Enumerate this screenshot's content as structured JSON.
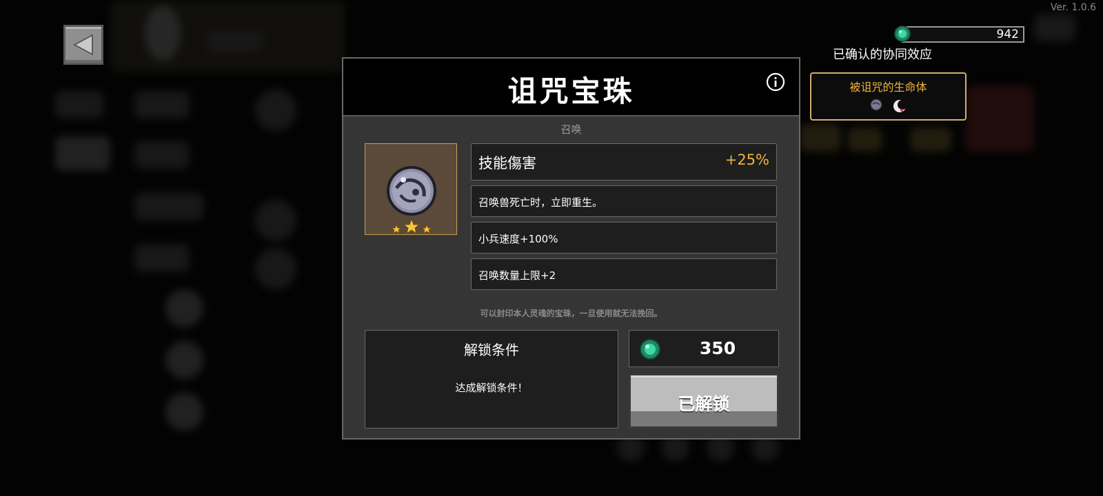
{
  "version": "Ver. 1.0.6",
  "currency": {
    "amount": "942",
    "icon": "emerald-gem-icon"
  },
  "synergy": {
    "title": "已确认的协同效应",
    "card_name": "被诅咒的生命体",
    "icons": [
      "cursed-orb-icon",
      "crescent-moon-icon"
    ]
  },
  "modal": {
    "title": "诅咒宝珠",
    "category": "召唤",
    "item_icon": "cursed-orb-icon",
    "star_count": 3,
    "main_stat": {
      "label": "技能傷害",
      "value": "+25%"
    },
    "effects": [
      "召唤兽死亡时，立即重生。",
      "小兵速度+100%",
      "召唤数量上限+2"
    ],
    "description": "可以封印本人灵魂的宝珠，一旦使用就无法挽回。",
    "unlock": {
      "title": "解锁条件",
      "condition": "达成解锁条件！"
    },
    "price": "350",
    "button_label": "已解锁"
  },
  "colors": {
    "accent_gold": "#f0b43c",
    "frame_gold": "#c9a24e",
    "gem_green": "#2fb98a"
  }
}
